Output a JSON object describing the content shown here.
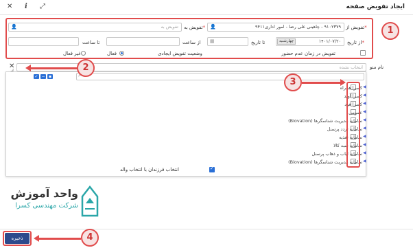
{
  "window": {
    "title": "ایجاد تفویض صفحه"
  },
  "titlebar": {
    "close_glyph": "✕",
    "info_glyph": "i",
    "expand_glyph": "⤢"
  },
  "form": {
    "from_user": {
      "label": "تفویض از",
      "value": "۹۱۰۲۳۷۹ - چاهینی علی رضا - امور اداری۹۴۱۱"
    },
    "to_user": {
      "label": "تفویض به",
      "placeholder": "تفویض به"
    },
    "from_date": {
      "label": "از تاریخ",
      "value": "۱۴۰۱/۰۷/۲۰",
      "weekday": "چهارشنبه"
    },
    "to_date": {
      "label": "تا تاریخ",
      "placeholder": ""
    },
    "from_time": {
      "label": "از ساعت",
      "placeholder": ""
    },
    "to_time": {
      "label": "تا ساعت",
      "placeholder": ""
    },
    "absence_checkbox_label": "تفویض در زمان عدم حضور",
    "status_label": "وضعیت تفویض ایجادی",
    "status_active": "فعال",
    "status_inactive": "غیر فعال",
    "menu_label": "نام منو",
    "menu_placeholder": "انتخاب نشده"
  },
  "tree": {
    "items": [
      "کسرا همراه",
      "کسرا آوید",
      "کسرا فود",
      "عمومی",
      "سامانه مدیریت شناسگرها (Biovation)",
      "سامانه تردد پرسنل",
      "سامانه تغذیه",
      "سامانه سبد کالا",
      "سامانه ایاب و ذهاب پرسنل",
      "سامانه مدیریت شناسگرها (Biovation)"
    ],
    "select_children_label": "انتخاب فرزندان با انتخاب والد"
  },
  "footer": {
    "save_label": "ذخیره"
  },
  "branding": {
    "name": "واحد آموزش",
    "sub": "شرکت مهندسی کسرا"
  },
  "annotations": {
    "b1": "1",
    "b2": "2",
    "b3": "3",
    "b4": "4"
  },
  "colors": {
    "accent": "#2a6fd6",
    "annotation_red": "#e14c4c",
    "save_button": "#2d4a8c",
    "logo_teal": "#2aa6a8"
  }
}
